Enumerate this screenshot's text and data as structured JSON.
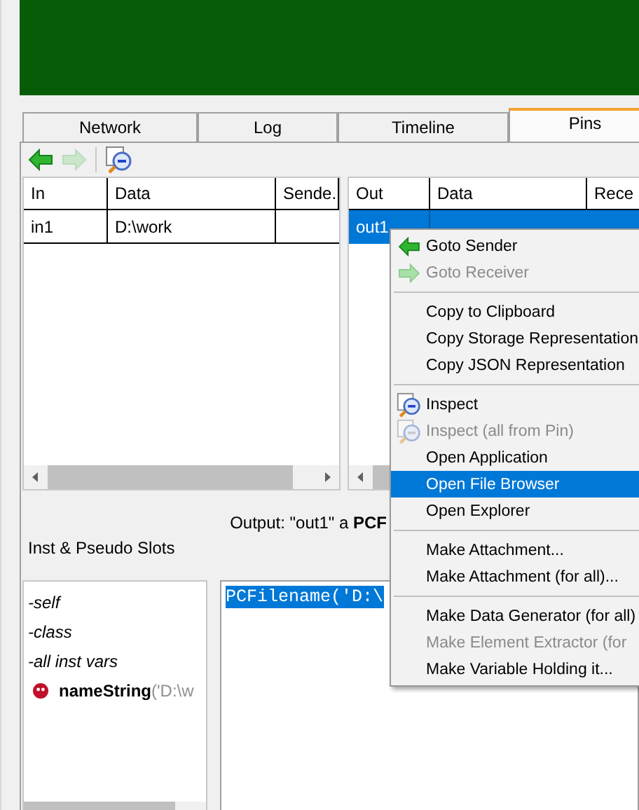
{
  "tabs": [
    {
      "label": "Network",
      "selected": false
    },
    {
      "label": "Log",
      "selected": false
    },
    {
      "label": "Timeline",
      "selected": false
    },
    {
      "label": "Pins",
      "selected": true
    }
  ],
  "toolbar": [
    {
      "kind": "back",
      "disabled": false
    },
    {
      "kind": "forward",
      "disabled": true
    },
    {
      "kind": "separator"
    },
    {
      "kind": "inspect",
      "disabled": false
    }
  ],
  "inputs_table": {
    "columns": [
      "In",
      "Data",
      "Sende.."
    ],
    "rows": [
      {
        "cells": [
          "in1",
          "D:\\work"
        ],
        "selected": false
      }
    ]
  },
  "outputs_table": {
    "columns": [
      "Out",
      "Data",
      "Rece"
    ],
    "rows": [
      {
        "cells": [
          "out1"
        ],
        "selected": true
      }
    ]
  },
  "output_label": "Output: \"out1\" a **PCF**",
  "slots_label": "Inst & Pseudo Slots",
  "slots": [
    {
      "kind": "pseudo",
      "name": "-self"
    },
    {
      "kind": "pseudo",
      "name": "-class"
    },
    {
      "kind": "pseudo",
      "name": "-all inst vars"
    },
    {
      "kind": "ivar",
      "name": "nameString",
      "value": "('D:\\w"
    }
  ],
  "code": {
    "text": "PCFilename('D:\\",
    "selected": true
  },
  "context_menu": [
    {
      "kind": "back",
      "label": "Goto Sender",
      "disabled": false,
      "selected": false
    },
    {
      "kind": "forward",
      "label": "Goto Receiver",
      "disabled": true,
      "selected": false
    },
    {
      "kind": "separator"
    },
    {
      "kind": "plain",
      "label": "Copy to Clipboard",
      "disabled": false,
      "selected": false
    },
    {
      "kind": "plain",
      "label": "Copy Storage Representation",
      "disabled": false,
      "selected": false
    },
    {
      "kind": "plain",
      "label": "Copy JSON Representation",
      "disabled": false,
      "selected": false
    },
    {
      "kind": "separator"
    },
    {
      "kind": "inspect",
      "label": "Inspect",
      "disabled": false,
      "selected": false
    },
    {
      "kind": "inspect",
      "label": "Inspect (all from Pin)",
      "disabled": true,
      "selected": false
    },
    {
      "kind": "plain",
      "label": "Open Application",
      "disabled": false,
      "selected": false
    },
    {
      "kind": "plain",
      "label": "Open File Browser",
      "disabled": false,
      "selected": true
    },
    {
      "kind": "plain",
      "label": "Open Explorer",
      "disabled": false,
      "selected": false
    },
    {
      "kind": "separator"
    },
    {
      "kind": "plain",
      "label": "Make Attachment...",
      "disabled": false,
      "selected": false
    },
    {
      "kind": "plain",
      "label": "Make Attachment (for all)...",
      "disabled": false,
      "selected": false
    },
    {
      "kind": "separator"
    },
    {
      "kind": "plain",
      "label": "Make Data Generator (for all)",
      "disabled": false,
      "selected": false
    },
    {
      "kind": "plain",
      "label": "Make Element Extractor (for",
      "disabled": true,
      "selected": false
    },
    {
      "kind": "plain",
      "label": "Make Variable Holding it...",
      "disabled": false,
      "selected": false
    }
  ]
}
